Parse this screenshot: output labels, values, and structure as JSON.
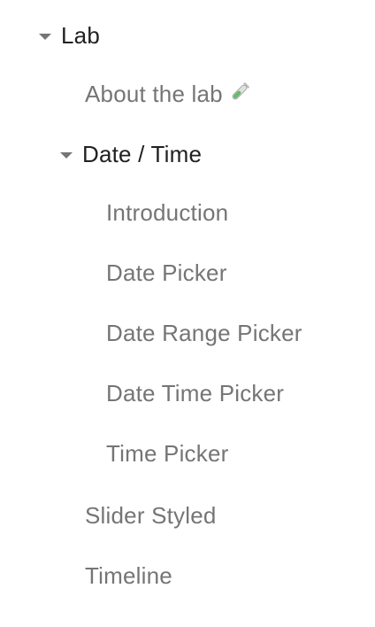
{
  "nav": {
    "lab": {
      "label": "Lab",
      "icon": "chevron-down-icon",
      "expanded": true
    },
    "about_lab": {
      "label": "About the lab",
      "emoji_icon": "test-tube-icon"
    },
    "date_time": {
      "label": "Date / Time",
      "icon": "chevron-down-icon",
      "expanded": true
    },
    "date_time_items": [
      {
        "label": "Introduction"
      },
      {
        "label": "Date Picker"
      },
      {
        "label": "Date Range Picker"
      },
      {
        "label": "Date Time Picker"
      },
      {
        "label": "Time Picker"
      }
    ],
    "slider_styled": {
      "label": "Slider Styled"
    },
    "timeline": {
      "label": "Timeline"
    }
  },
  "colors": {
    "group_text": "#212121",
    "item_text": "#757575",
    "caret": "#757575",
    "tube_glass": "#E0E0E0",
    "tube_liquid": "#66BB6A"
  }
}
